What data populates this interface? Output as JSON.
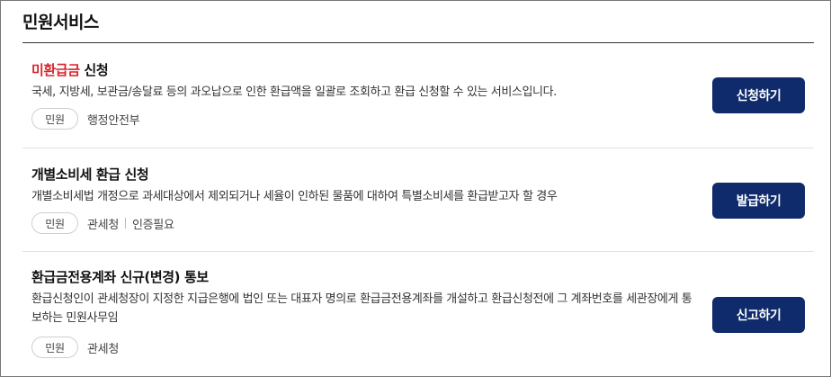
{
  "page": {
    "title": "민원서비스"
  },
  "services": [
    {
      "title_highlight": "미환급금",
      "title_rest": " 신청",
      "description": "국세, 지방세, 보관금/송달료 등의 과오납으로 인한 환급액을 일괄로 조회하고 환급 신청할 수 있는 서비스입니다.",
      "tag": "민원",
      "agency": "행정안전부",
      "extra": "",
      "button_label": "신청하기"
    },
    {
      "title_highlight": "",
      "title_rest": "개별소비세 환급 신청",
      "description": "개별소비세법 개정으로 과세대상에서 제외되거나 세율이 인하된 물품에 대하여 특별소비세를 환급받고자 할 경우",
      "tag": "민원",
      "agency": "관세청",
      "extra": "인증필요",
      "button_label": "발급하기"
    },
    {
      "title_highlight": "",
      "title_rest": "환급금전용계좌 신규(변경) 통보",
      "description": "환급신청인이 관세청장이 지정한 지급은행에 법인 또는 대표자 명의로 환급금전용계좌를 개설하고 환급신청전에 그 계좌번호를 세관장에게 통보하는 민원사무임",
      "tag": "민원",
      "agency": "관세청",
      "extra": "",
      "button_label": "신고하기"
    }
  ],
  "colors": {
    "button_bg": "#0f2b6b",
    "highlight": "#d8232a"
  }
}
